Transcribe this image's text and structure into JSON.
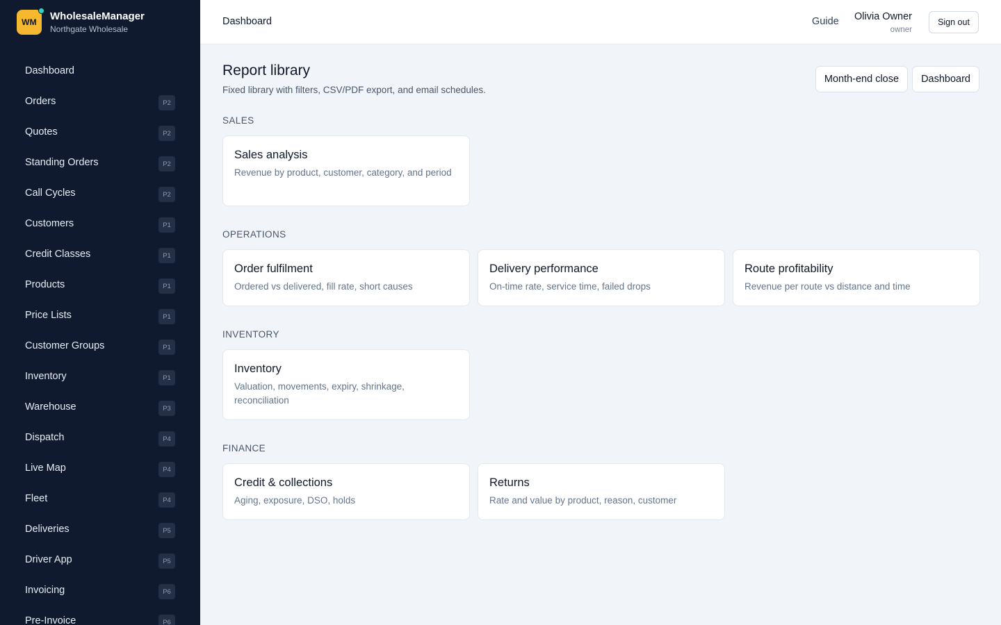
{
  "brand": {
    "logo_text": "WM",
    "name": "WholesaleManager",
    "org": "Northgate Wholesale"
  },
  "sidebar": {
    "items": [
      {
        "label": "Dashboard",
        "badge": ""
      },
      {
        "label": "Orders",
        "badge": "P2"
      },
      {
        "label": "Quotes",
        "badge": "P2"
      },
      {
        "label": "Standing Orders",
        "badge": "P2"
      },
      {
        "label": "Call Cycles",
        "badge": "P2"
      },
      {
        "label": "Customers",
        "badge": "P1"
      },
      {
        "label": "Credit Classes",
        "badge": "P1"
      },
      {
        "label": "Products",
        "badge": "P1"
      },
      {
        "label": "Price Lists",
        "badge": "P1"
      },
      {
        "label": "Customer Groups",
        "badge": "P1"
      },
      {
        "label": "Inventory",
        "badge": "P1"
      },
      {
        "label": "Warehouse",
        "badge": "P3"
      },
      {
        "label": "Dispatch",
        "badge": "P4"
      },
      {
        "label": "Live Map",
        "badge": "P4"
      },
      {
        "label": "Fleet",
        "badge": "P4"
      },
      {
        "label": "Deliveries",
        "badge": "P5"
      },
      {
        "label": "Driver App",
        "badge": "P5"
      },
      {
        "label": "Invoicing",
        "badge": "P6"
      },
      {
        "label": "Pre-Invoice",
        "badge": "P6"
      }
    ]
  },
  "header": {
    "breadcrumb": "Dashboard",
    "guide": "Guide",
    "user_name": "Olivia Owner",
    "user_role": "owner",
    "sign_out": "Sign out"
  },
  "main": {
    "title": "Report library",
    "subtitle": "Fixed library with filters, CSV/PDF export, and email schedules.",
    "actions": [
      "Month-end close",
      "Dashboard"
    ],
    "sections": [
      {
        "label": "SALES",
        "cards": [
          {
            "title": "Sales analysis",
            "desc": "Revenue by product, customer, category, and period"
          }
        ]
      },
      {
        "label": "OPERATIONS",
        "cards": [
          {
            "title": "Order fulfilment",
            "desc": "Ordered vs delivered, fill rate, short causes"
          },
          {
            "title": "Delivery performance",
            "desc": "On-time rate, service time, failed drops"
          },
          {
            "title": "Route profitability",
            "desc": "Revenue per route vs distance and time"
          }
        ]
      },
      {
        "label": "INVENTORY",
        "cards": [
          {
            "title": "Inventory",
            "desc": "Valuation, movements, expiry, shrinkage, reconciliation"
          }
        ]
      },
      {
        "label": "FINANCE",
        "cards": [
          {
            "title": "Credit & collections",
            "desc": "Aging, exposure, DSO, holds"
          },
          {
            "title": "Returns",
            "desc": "Rate and value by product, reason, customer"
          }
        ]
      }
    ]
  }
}
